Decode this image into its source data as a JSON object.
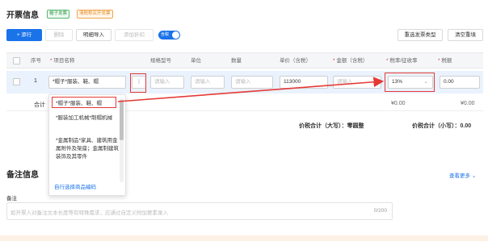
{
  "invoice_section": {
    "title": "开票信息",
    "tags": [
      "帽子发票",
      "清税称买开发票"
    ]
  },
  "toolbar": {
    "add_row": "+ 添行",
    "delete": "删除",
    "import_detail": "明细导入",
    "add_discount": "添加折扣",
    "tax_toggle_label": "含税",
    "reselect_type": "重选发票类型",
    "clear_refill": "清空重填"
  },
  "table": {
    "headers": {
      "index": "序号",
      "item_name": "项目名称",
      "spec": "规格型号",
      "unit": "单位",
      "quantity": "数量",
      "price": "单价（含税）",
      "amount": "金额（含税）",
      "tax_rate": "税率/征收率",
      "tax": "税额"
    },
    "row": {
      "index": "1",
      "item_name": "*帽子*服装、鞋、帽",
      "more_button": "⋮",
      "spec_placeholder": "请输入",
      "unit_placeholder": "请输入",
      "quantity_placeholder": "请输入",
      "price": "113000",
      "amount_placeholder": "请输入",
      "tax_rate": "13%",
      "tax": "0.00"
    },
    "total": {
      "label": "合计",
      "amount": "¥0.00",
      "tax": "¥0.00"
    },
    "grand_total": {
      "upper_label": "价税合计（大写）：",
      "upper_value": "零圆整",
      "lower_label": "价税合计（小写）：",
      "lower_value": "0.00"
    }
  },
  "dropdown": {
    "items": [
      "*帽子*服装、鞋、帽",
      "*服装加工机械*制帽机械",
      "*金属制品*家具、建筑用金属附件及架座；金属制建筑装饰及其零件"
    ],
    "footer_link": "自行选择商品编码"
  },
  "remarks_section": {
    "title": "备注信息",
    "view_more": "查看更多",
    "field_label": "备注",
    "placeholder": "如开票人对备注文本长度等有特殊需求，应通过自定义附加要素录入",
    "counter": "0/200"
  },
  "colors": {
    "primary": "#1a73e8",
    "highlight": "#e53935",
    "row_selected": "#eaf2fd"
  }
}
